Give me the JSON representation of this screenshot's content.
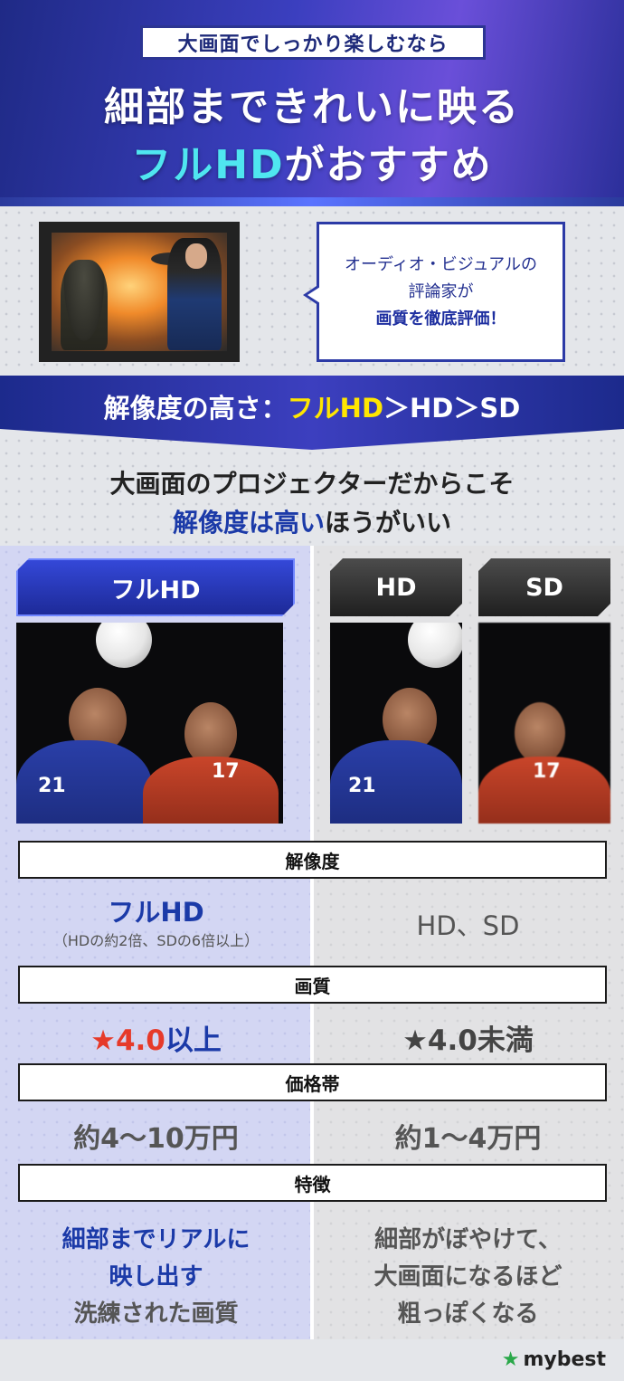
{
  "header": {
    "tag": "大画面でしっかり楽しむなら",
    "line1": "細部まできれいに映る",
    "line2_highlight": "フルHD",
    "line2_rest": "がおすすめ"
  },
  "critic": {
    "line1": "オーディオ・ビジュアルの",
    "line2": "評論家が",
    "line3": "画質を徹底評価！"
  },
  "banner": {
    "prefix": "解像度の高さ：",
    "highlight": "フルHD",
    "rest": "＞HD＞SD"
  },
  "subhead": {
    "line1": "大画面のプロジェクターだからこそ",
    "line2_highlight": "解像度は高い",
    "line2_rest": "ほうがいい"
  },
  "tabs": {
    "full": "フルHD",
    "hd": "HD",
    "sd": "SD"
  },
  "categories": {
    "resolution": "解像度",
    "quality": "画質",
    "price": "価格帯",
    "feature": "特徴"
  },
  "left": {
    "resolution_main": "フルHD",
    "resolution_sub": "（HDの約2倍、SDの6倍以上）",
    "quality_star": "★",
    "quality_value": "4.0",
    "quality_suffix": "以上",
    "price": "約4〜10万円",
    "feature_1": "細部までリアルに",
    "feature_2": "映し出す",
    "feature_3": "洗練された画質"
  },
  "right": {
    "resolution": "HD、SD",
    "quality": "★4.0未満",
    "price": "約1〜4万円",
    "feature_1": "細部がぼやけて、",
    "feature_2": "大画面になるほど",
    "feature_3": "粗っぽくなる"
  },
  "soccer": {
    "blue_number": "21",
    "red_number": "17"
  },
  "logo": {
    "star": "★",
    "text": "mybest"
  },
  "colors": {
    "accent_blue": "#1b3aa8",
    "star_red": "#e63a2a",
    "brand_green": "#2aa84a"
  }
}
